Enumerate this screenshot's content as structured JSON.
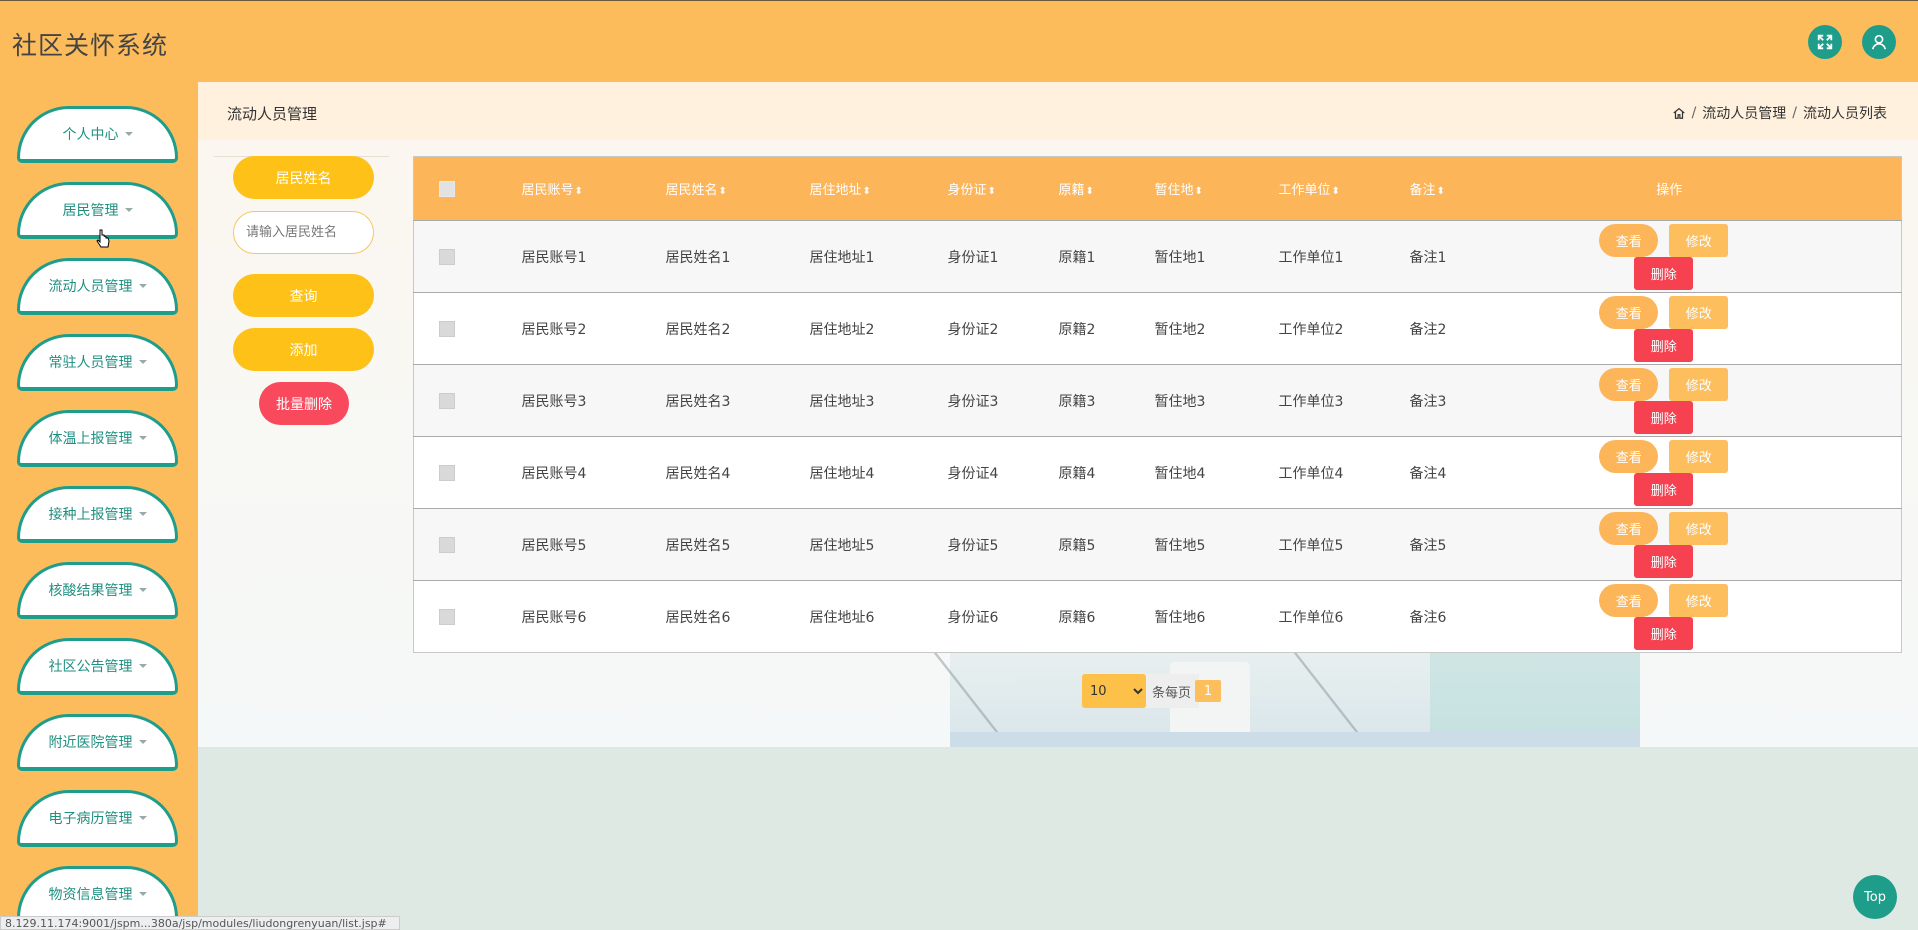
{
  "app": {
    "title": "社区关怀系统"
  },
  "header": {
    "fullscreen_icon": "fullscreen-icon",
    "user_icon": "user-icon"
  },
  "sidebar": {
    "items": [
      {
        "label": "个人中心"
      },
      {
        "label": "居民管理"
      },
      {
        "label": "流动人员管理"
      },
      {
        "label": "常驻人员管理"
      },
      {
        "label": "体温上报管理"
      },
      {
        "label": "接种上报管理"
      },
      {
        "label": "核酸结果管理"
      },
      {
        "label": "社区公告管理"
      },
      {
        "label": "附近医院管理"
      },
      {
        "label": "电子病历管理"
      },
      {
        "label": "物资信息管理"
      }
    ]
  },
  "page": {
    "title": "流动人员管理",
    "breadcrumb": [
      "流动人员管理",
      "流动人员列表"
    ]
  },
  "search": {
    "field_label": "居民姓名",
    "input_placeholder": "请输入居民姓名",
    "query_label": "查询",
    "add_label": "添加",
    "batch_delete_label": "批量删除"
  },
  "table": {
    "columns": [
      "居民账号",
      "居民姓名",
      "居住地址",
      "身份证",
      "原籍",
      "暂住地",
      "工作单位",
      "备注",
      "操作"
    ],
    "rows": [
      [
        "居民账号1",
        "居民姓名1",
        "居住地址1",
        "身份证1",
        "原籍1",
        "暂住地1",
        "工作单位1",
        "备注1"
      ],
      [
        "居民账号2",
        "居民姓名2",
        "居住地址2",
        "身份证2",
        "原籍2",
        "暂住地2",
        "工作单位2",
        "备注2"
      ],
      [
        "居民账号3",
        "居民姓名3",
        "居住地址3",
        "身份证3",
        "原籍3",
        "暂住地3",
        "工作单位3",
        "备注3"
      ],
      [
        "居民账号4",
        "居民姓名4",
        "居住地址4",
        "身份证4",
        "原籍4",
        "暂住地4",
        "工作单位4",
        "备注4"
      ],
      [
        "居民账号5",
        "居民姓名5",
        "居住地址5",
        "身份证5",
        "原籍5",
        "暂住地5",
        "工作单位5",
        "备注5"
      ],
      [
        "居民账号6",
        "居民姓名6",
        "居住地址6",
        "身份证6",
        "原籍6",
        "暂住地6",
        "工作单位6",
        "备注6"
      ]
    ],
    "actions": {
      "view": "查看",
      "edit": "修改",
      "delete": "删除"
    }
  },
  "pagination": {
    "page_size": "10",
    "page_size_options": [
      "10"
    ],
    "per_page_label": "条每页",
    "current_page": "1"
  },
  "top_button": "Top",
  "status_url": "8.129.11.174:9001/jspm...380a/jsp/modules/liudongrenyuan/list.jsp#",
  "colors": {
    "header_bg": "#fdbc5c",
    "accent_teal": "#1f9d8b",
    "button_yellow": "#fdc117",
    "delete_red": "#f64150"
  }
}
